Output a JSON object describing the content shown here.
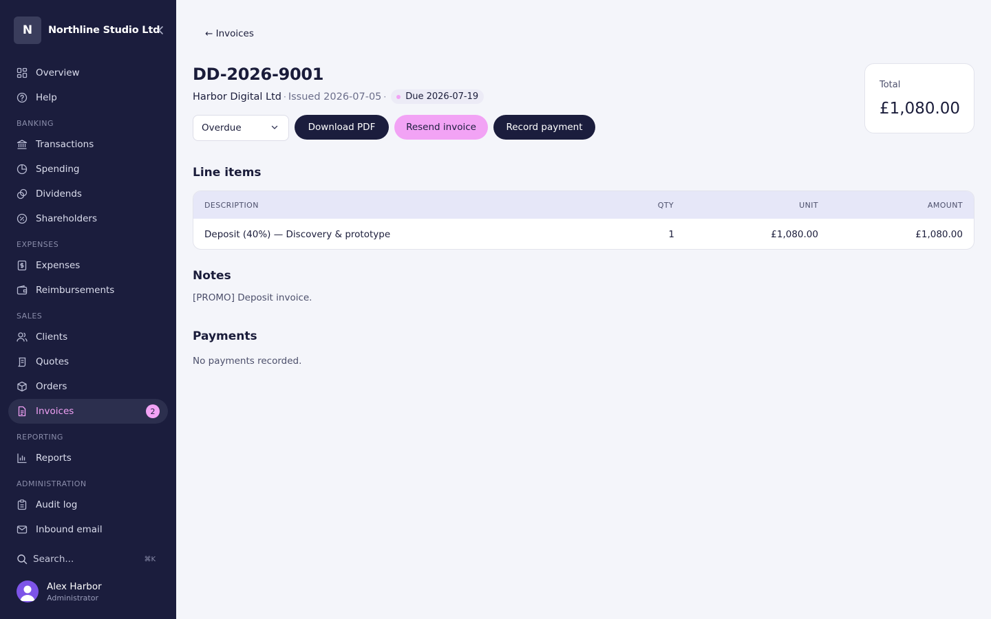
{
  "sidebar": {
    "brand_initial": "N",
    "brand_name": "Northline Studio Ltd",
    "items": {
      "overview": "Overview",
      "help": "Help",
      "transactions": "Transactions",
      "spending": "Spending",
      "dividends": "Dividends",
      "shareholders": "Shareholders",
      "expenses": "Expenses",
      "reimbursements": "Reimbursements",
      "clients": "Clients",
      "quotes": "Quotes",
      "orders": "Orders",
      "invoices": "Invoices",
      "reports": "Reports",
      "audit_log": "Audit log",
      "inbound_email": "Inbound email"
    },
    "invoices_badge": "2",
    "sections": {
      "banking": "BANKING",
      "expenses": "EXPENSES",
      "sales": "SALES",
      "reporting": "REPORTING",
      "administration": "ADMINISTRATION"
    },
    "search_placeholder": "Search...",
    "search_shortcut": "⌘K",
    "user": {
      "name": "Alex Harbor",
      "role": "Administrator"
    }
  },
  "page": {
    "back_label": "← Invoices",
    "invoice_number": "DD-2026-9001",
    "client": "Harbor Digital Ltd",
    "separator": "·",
    "issued": "Issued 2026-07-05",
    "due": "Due 2026-07-19",
    "status_value": "Overdue",
    "buttons": {
      "download": "Download PDF",
      "resend": "Resend invoice",
      "record": "Record payment"
    },
    "total": {
      "label": "Total",
      "value": "£1,080.00"
    },
    "line_items": {
      "title": "Line items",
      "columns": {
        "description": "DESCRIPTION",
        "qty": "QTY",
        "unit": "UNIT",
        "amount": "AMOUNT"
      },
      "rows": [
        {
          "description": "Deposit (40%) — Discovery & prototype",
          "qty": "1",
          "unit": "£1,080.00",
          "amount": "£1,080.00"
        }
      ]
    },
    "notes": {
      "title": "Notes",
      "text": "[PROMO] Deposit invoice."
    },
    "payments": {
      "title": "Payments",
      "text": "No payments recorded."
    }
  },
  "colors": {
    "sidebar_bg": "#1b1d3d",
    "accent_pink": "#f2a3f5",
    "page_bg": "#f4f5fa",
    "table_header": "#e6e7f8"
  }
}
